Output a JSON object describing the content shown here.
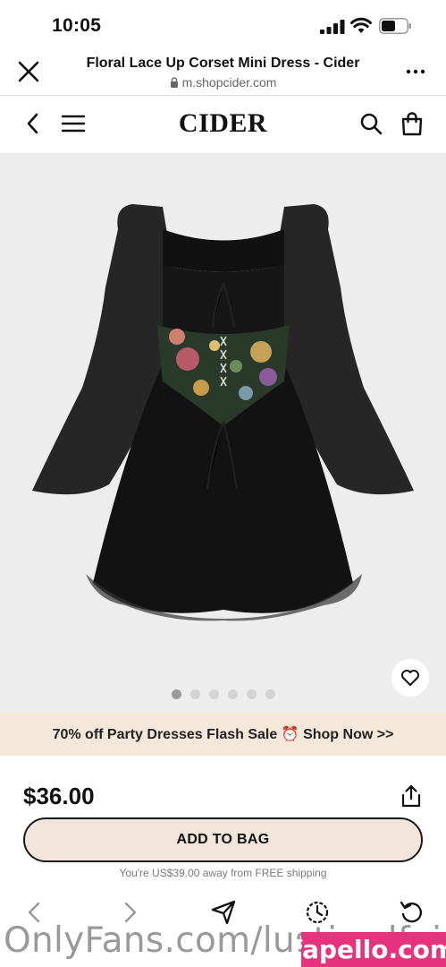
{
  "status_bar": {
    "time": "10:05"
  },
  "browser": {
    "page_title": "Floral Lace Up Corset Mini Dress - Cider",
    "url": "m.shopcider.com"
  },
  "site": {
    "brand": "CIDER"
  },
  "product": {
    "image_dot_count": 6,
    "active_dot": 0,
    "price": "$36.00",
    "add_to_bag_label": "ADD TO BAG",
    "shipping_note": "You're US$39.00 away from FREE shipping"
  },
  "promo": {
    "text": "70% off Party Dresses Flash Sale ⏰ Shop Now >>"
  },
  "watermark": {
    "text": "OnlyFans.com/lustiwolfei",
    "logo": "fapello.com"
  },
  "colors": {
    "banner_bg": "#f4e8da",
    "button_bg": "#f2e6dc",
    "watermark_logo": "#e8327e"
  }
}
